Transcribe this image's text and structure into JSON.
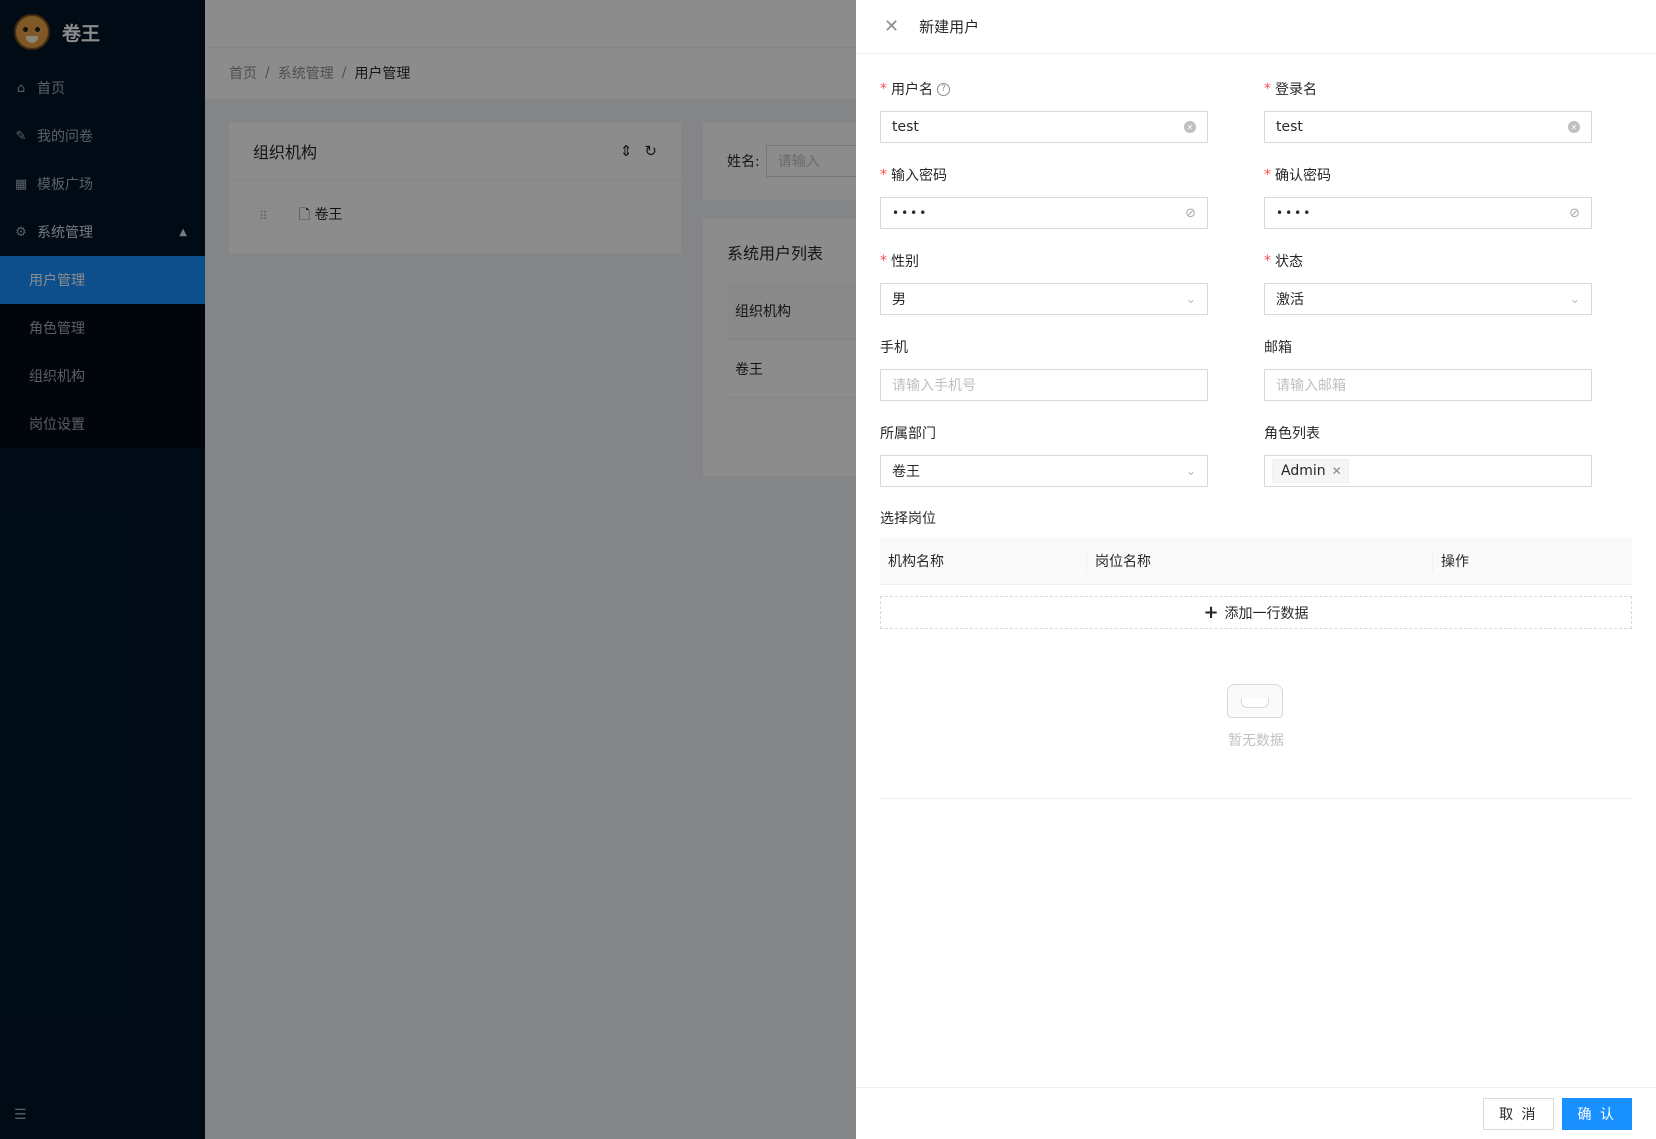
{
  "app": {
    "title": "卷王"
  },
  "sidebar": {
    "items": [
      {
        "label": "首页",
        "icon": "home-icon"
      },
      {
        "label": "我的问卷",
        "icon": "edit-icon"
      },
      {
        "label": "模板广场",
        "icon": "appstore-icon"
      }
    ],
    "system": {
      "label": "系统管理",
      "icon": "setting-icon",
      "children": [
        {
          "label": "用户管理",
          "active": true
        },
        {
          "label": "角色管理"
        },
        {
          "label": "组织机构"
        },
        {
          "label": "岗位设置"
        }
      ]
    }
  },
  "breadcrumb": [
    "首页",
    "系统管理",
    "用户管理"
  ],
  "background": {
    "org_card_title": "组织机构",
    "tree_node": "卷王",
    "search_label": "姓名:",
    "search_placeholder": "请输入",
    "list_title": "系统用户列表",
    "list_column": "组织机构",
    "list_row": "卷王"
  },
  "drawer": {
    "title": "新建用户",
    "fields": {
      "username": {
        "label": "用户名",
        "value": "test",
        "required": true
      },
      "login": {
        "label": "登录名",
        "value": "test",
        "required": true
      },
      "password": {
        "label": "输入密码",
        "value": "••••",
        "required": true
      },
      "confirm": {
        "label": "确认密码",
        "value": "••••",
        "required": true
      },
      "gender": {
        "label": "性别",
        "value": "男",
        "required": true
      },
      "status": {
        "label": "状态",
        "value": "激活",
        "required": true
      },
      "phone": {
        "label": "手机",
        "placeholder": "请输入手机号"
      },
      "email": {
        "label": "邮箱",
        "placeholder": "请输入邮箱"
      },
      "dept": {
        "label": "所属部门",
        "value": "卷王"
      },
      "roles": {
        "label": "角色列表",
        "tags": [
          "Admin"
        ]
      }
    },
    "positions": {
      "label": "选择岗位",
      "columns": [
        "机构名称",
        "岗位名称",
        "操作"
      ],
      "add_row": "添加一行数据",
      "empty": "暂无数据"
    },
    "footer": {
      "cancel": "取 消",
      "confirm": "确 认"
    }
  },
  "colors": {
    "sider": "#001529",
    "primary": "#1890ff",
    "required": "#ff4d4f"
  }
}
